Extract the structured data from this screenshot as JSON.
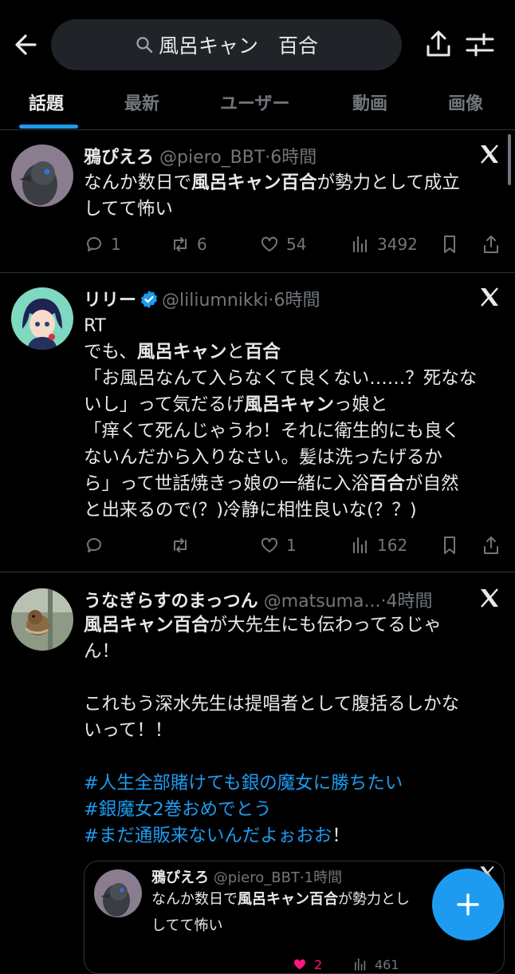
{
  "search": {
    "query": "風呂キャン　百合"
  },
  "tabs": [
    "話題",
    "最新",
    "ユーザー",
    "動画",
    "画像"
  ],
  "posts": [
    {
      "name": "鴉ぴえろ",
      "handle": "@piero_BBT",
      "time": "·6時間",
      "lines": [
        [
          {
            "t": "なんか数日で"
          },
          {
            "t": "風呂キャン百合",
            "b": true
          },
          {
            "t": "が勢力として成立"
          }
        ],
        [
          {
            "t": "してて怖い"
          }
        ]
      ],
      "replies": "1",
      "reposts": "6",
      "likes": "54",
      "views": "3492"
    },
    {
      "name": "リリー",
      "handle": "@liliumnikki",
      "time": "·6時間",
      "verified": true,
      "lines": [
        [
          {
            "t": "RT"
          }
        ],
        [
          {
            "t": "でも、"
          },
          {
            "t": "風呂キャン",
            "b": true
          },
          {
            "t": "と"
          },
          {
            "t": "百合",
            "b": true
          }
        ],
        [
          {
            "t": "「お風呂なんて入らなくて良くない……？死なな"
          }
        ],
        [
          {
            "t": "いし」って気だるげ"
          },
          {
            "t": "風呂キャン",
            "b": true
          },
          {
            "t": "っ娘と"
          }
        ],
        [
          {
            "t": "「痒くて死んじゃうわ！それに衛生的にも良く"
          }
        ],
        [
          {
            "t": "ないんだから入りなさい。髪は洗ったげるか"
          }
        ],
        [
          {
            "t": "ら」って世話焼きっ娘の一緒に入浴"
          },
          {
            "t": "百合",
            "b": true
          },
          {
            "t": "が自然"
          }
        ],
        [
          {
            "t": "と出来るので(？)冷静に相性良いな(？？)"
          }
        ]
      ],
      "replies": "",
      "reposts": "",
      "likes": "1",
      "views": "162"
    },
    {
      "name": "うなぎらすのまっつん",
      "handle": "@matsuma...",
      "time": "·4時間",
      "lines": [
        [
          {
            "t": "風呂キャン百合",
            "b": true
          },
          {
            "t": "が大先生にも伝わってるじゃ"
          }
        ],
        [
          {
            "t": "ん！"
          }
        ],
        [
          {
            "t": " "
          }
        ],
        [
          {
            "t": "これもう深水先生は提唱者として腹括るしかな"
          }
        ],
        [
          {
            "t": "いって！！"
          }
        ],
        [
          {
            "t": " "
          }
        ],
        [
          {
            "t": "#人生全部賭けても銀の魔女に勝ちたい",
            "tag": true
          }
        ],
        [
          {
            "t": "#銀魔女2巻おめでとう",
            "tag": true
          }
        ],
        [
          {
            "t": "#まだ通販来ないんだよぉおお",
            "tag": true
          },
          {
            "t": "！"
          }
        ]
      ]
    }
  ],
  "quote": {
    "name": "鴉ぴえろ",
    "handle": "@piero_BBT",
    "time": "·1時間",
    "lines": [
      [
        {
          "t": "なんか数日で"
        },
        {
          "t": "風呂キャン百合",
          "b": true
        },
        {
          "t": "が勢力とし"
        }
      ],
      [
        {
          "t": "してて怖い"
        }
      ]
    ],
    "likes": "2",
    "views": "461"
  },
  "colors": {
    "accent": "#1d9bf0",
    "muted": "#71767b",
    "background": "#000000",
    "like": "#f91880"
  },
  "icons": [
    "back-arrow-icon",
    "search-icon",
    "share-icon",
    "filter-icon",
    "x-logo-icon",
    "verified-badge-icon",
    "reply-icon",
    "repost-icon",
    "like-icon",
    "views-icon",
    "bookmark-icon",
    "compose-plus-icon"
  ]
}
